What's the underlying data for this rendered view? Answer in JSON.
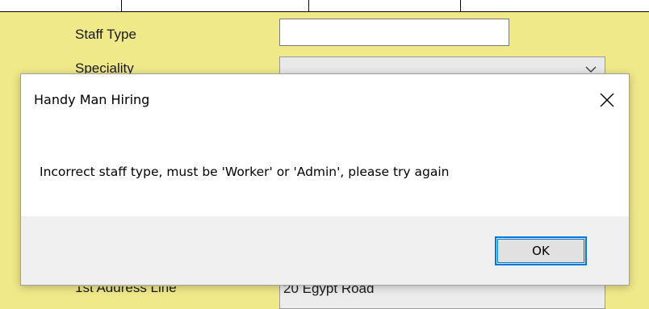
{
  "background_form": {
    "staff_type_label": "Staff Type",
    "staff_type_value": "",
    "speciality_label": "Speciality",
    "address_label": "1st Address Line",
    "address_value": "20 Egypt Road"
  },
  "dialog": {
    "title": "Handy Man Hiring",
    "message": "Incorrect staff type, must be 'Worker' or 'Admin', please try again",
    "ok_label": "OK",
    "close_icon": "close-icon"
  },
  "colors": {
    "form_background": "#f0e98a",
    "dialog_footer": "#f0f0f0",
    "button_focus_border": "#0078d7"
  }
}
